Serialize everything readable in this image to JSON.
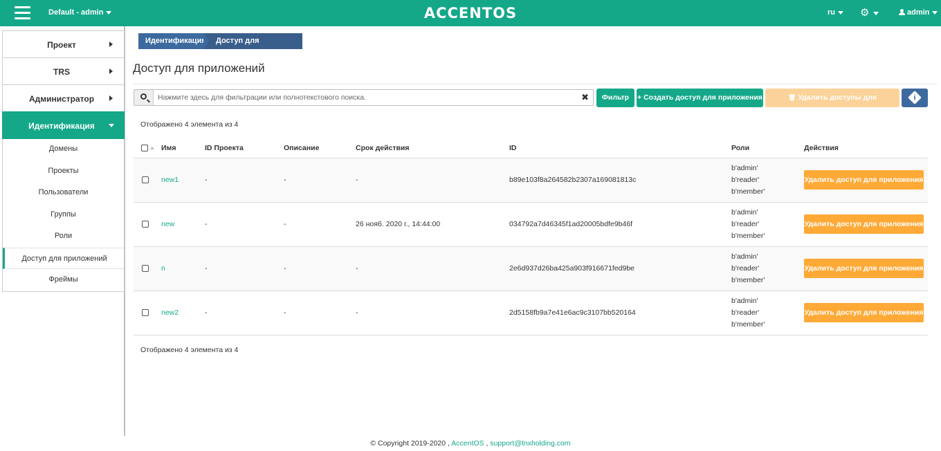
{
  "header": {
    "project": "Default - admin",
    "logo": "ACCENTOS",
    "lang": "ru",
    "user": "admin",
    "menu_icon": "hamburger-icon",
    "settings_icon": "gear-icon",
    "user_icon": "user-icon",
    "bg_color": "#14a889"
  },
  "sidebar": {
    "items": [
      {
        "label": "Проект"
      },
      {
        "label": "TRS"
      },
      {
        "label": "Администратор"
      },
      {
        "label": "Идентификация"
      }
    ],
    "sub_items": [
      {
        "label": "Домены"
      },
      {
        "label": "Проекты"
      },
      {
        "label": "Пользователи"
      },
      {
        "label": "Группы"
      },
      {
        "label": "Роли"
      },
      {
        "label": "Доступ для приложений"
      },
      {
        "label": "Фреймы"
      }
    ]
  },
  "breadcrumb": [
    "Идентификация",
    "Доступ для приложений"
  ],
  "page": {
    "title": "Доступ для приложений",
    "search_placeholder": "Нажмите здесь для фильтрации или полнотекстового поиска.",
    "clear": "✖",
    "filter_label": "Фильтр",
    "create_label": "Создать доступ для приложения",
    "create_icon": "+",
    "delete_label": "Удалить доступы для приложений",
    "delete_icon": "🗑",
    "info_icon": "i",
    "count_text": "Отображено 4 элемента из 4"
  },
  "table": {
    "headers": [
      "Имя",
      "ID Проекта",
      "Описание",
      "Срок действия",
      "ID",
      "Роли",
      "Действия"
    ],
    "rows": [
      {
        "name": "new1",
        "project_id": "-",
        "description": "-",
        "expires": "-",
        "id": "b89e103f8a264582b2307a169081813c",
        "roles": [
          "b'admin'",
          "b'reader'",
          "b'member'"
        ],
        "action": "Удалить доступ для приложения"
      },
      {
        "name": "new",
        "project_id": "-",
        "description": "-",
        "expires": "26 нояб. 2020 г., 14:44:00",
        "id": "034792a7d46345f1ad20005bdfe9b46f",
        "roles": [
          "b'admin'",
          "b'reader'",
          "b'member'"
        ],
        "action": "Удалить доступ для приложения"
      },
      {
        "name": "n",
        "project_id": "-",
        "description": "-",
        "expires": "-",
        "id": "2e6d937d26ba425a903f916671fed9be",
        "roles": [
          "b'admin'",
          "b'reader'",
          "b'member'"
        ],
        "action": "Удалить доступ для приложения"
      },
      {
        "name": "new2",
        "project_id": "-",
        "description": "-",
        "expires": "-",
        "id": "2d5158fb9a7e41e6ac9c3107bb520164",
        "roles": [
          "b'admin'",
          "b'reader'",
          "b'member'"
        ],
        "action": "Удалить доступ для приложения"
      }
    ]
  },
  "footer": {
    "copyright": "© Copyright 2019-2020 ,",
    "brand": "AccentOS",
    "sep": ",",
    "email": "support@tnxholding.com"
  }
}
